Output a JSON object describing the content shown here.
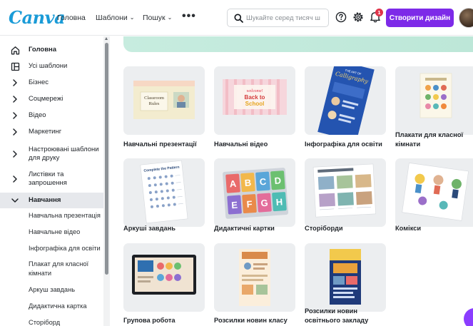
{
  "header": {
    "logo": "Canva",
    "nav": {
      "home": "Головна",
      "templates": "Шаблони",
      "templates_chevron": "⌄",
      "search_menu": "Пошук",
      "search_chevron": "⌄",
      "more": "•••"
    },
    "search": {
      "placeholder": "Шукайте серед тисяч ш",
      "value": ""
    },
    "notification_count": "1",
    "create_button": "Створити дизайн"
  },
  "sidebar": {
    "items": [
      {
        "label": "Головна",
        "icon": "home-icon"
      },
      {
        "label": "Усі шаблони",
        "icon": "templates-icon"
      },
      {
        "label": "Бізнес",
        "icon": "chevron-right-icon"
      },
      {
        "label": "Соцмережі",
        "icon": "chevron-right-icon"
      },
      {
        "label": "Відео",
        "icon": "chevron-right-icon"
      },
      {
        "label": "Маркетинг",
        "icon": "chevron-right-icon"
      },
      {
        "label": "Настроювані шаблони для друку",
        "icon": "chevron-right-icon"
      },
      {
        "label": "Листівки та запрошення",
        "icon": "chevron-right-icon"
      },
      {
        "label": "Навчання",
        "icon": "chevron-down-icon"
      }
    ],
    "subitems": [
      "Навчальна презентація",
      "Навчальне відео",
      "Інфографіка для освіти",
      "Плакат для класної кімнати",
      "Аркуш завдань",
      "Дидактична картка",
      "Сторіборд"
    ]
  },
  "cards": [
    {
      "label": "Навчальні презентації",
      "thumb_text": "Classroom Rules"
    },
    {
      "label": "Навчальні відео",
      "thumb_text": "Welcome! Back to School"
    },
    {
      "label": "Інфографіка для освіти",
      "thumb_text": "THE ART OF Calligraphy"
    },
    {
      "label": "Плакати для класної кімнати"
    },
    {
      "label": "Аркуші завдань",
      "thumb_text": "Complete the Pattern"
    },
    {
      "label": "Дидактичні картки",
      "thumb_letters": [
        "A",
        "B",
        "C",
        "D",
        "E",
        "F",
        "G",
        "H"
      ]
    },
    {
      "label": "Сторіборди"
    },
    {
      "label": "Комікси"
    },
    {
      "label": "Групова робота"
    },
    {
      "label": "Розсилки новин класу"
    },
    {
      "label": "Розсилки новин освітнього закладу"
    }
  ],
  "colors": {
    "brand": "#1a9bd7",
    "primary_button": "#7d2ae8",
    "notification_badge": "#e0344a",
    "active_sidebar": "#e6e8ec",
    "banner": "#c7ecdf"
  }
}
